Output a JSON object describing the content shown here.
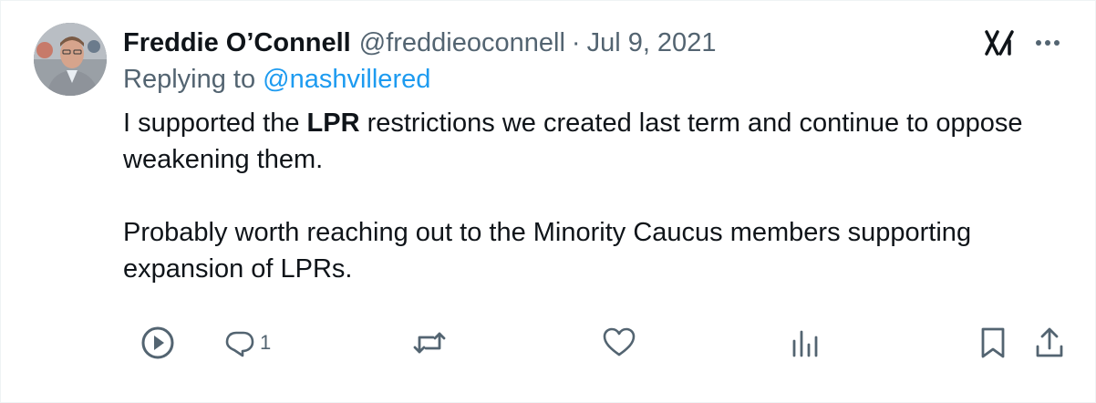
{
  "tweet": {
    "author_name": "Freddie O’Connell",
    "handle": "@freddieoconnell",
    "separator": "·",
    "date": "Jul 9, 2021",
    "replying_label": "Replying to",
    "replying_to": "@nashvillered",
    "body": {
      "line1_before": "I supported the ",
      "line1_bold": "LPR",
      "line1_after": " restrictions we created last term and continue to oppose weakening them.",
      "paragraph2": "Probably worth reaching out to the Minority Caucus members supporting expansion of LPRs."
    }
  },
  "actions": {
    "reply_count": "1"
  },
  "icons": {
    "grok": "grok-icon",
    "more": "more-icon",
    "play": "play-icon",
    "reply": "reply-icon",
    "retweet": "retweet-icon",
    "like": "like-icon",
    "views": "views-icon",
    "bookmark": "bookmark-icon",
    "share": "share-icon"
  },
  "colors": {
    "text": "#0f1419",
    "secondary": "#536471",
    "accent": "#1d9bf0"
  }
}
